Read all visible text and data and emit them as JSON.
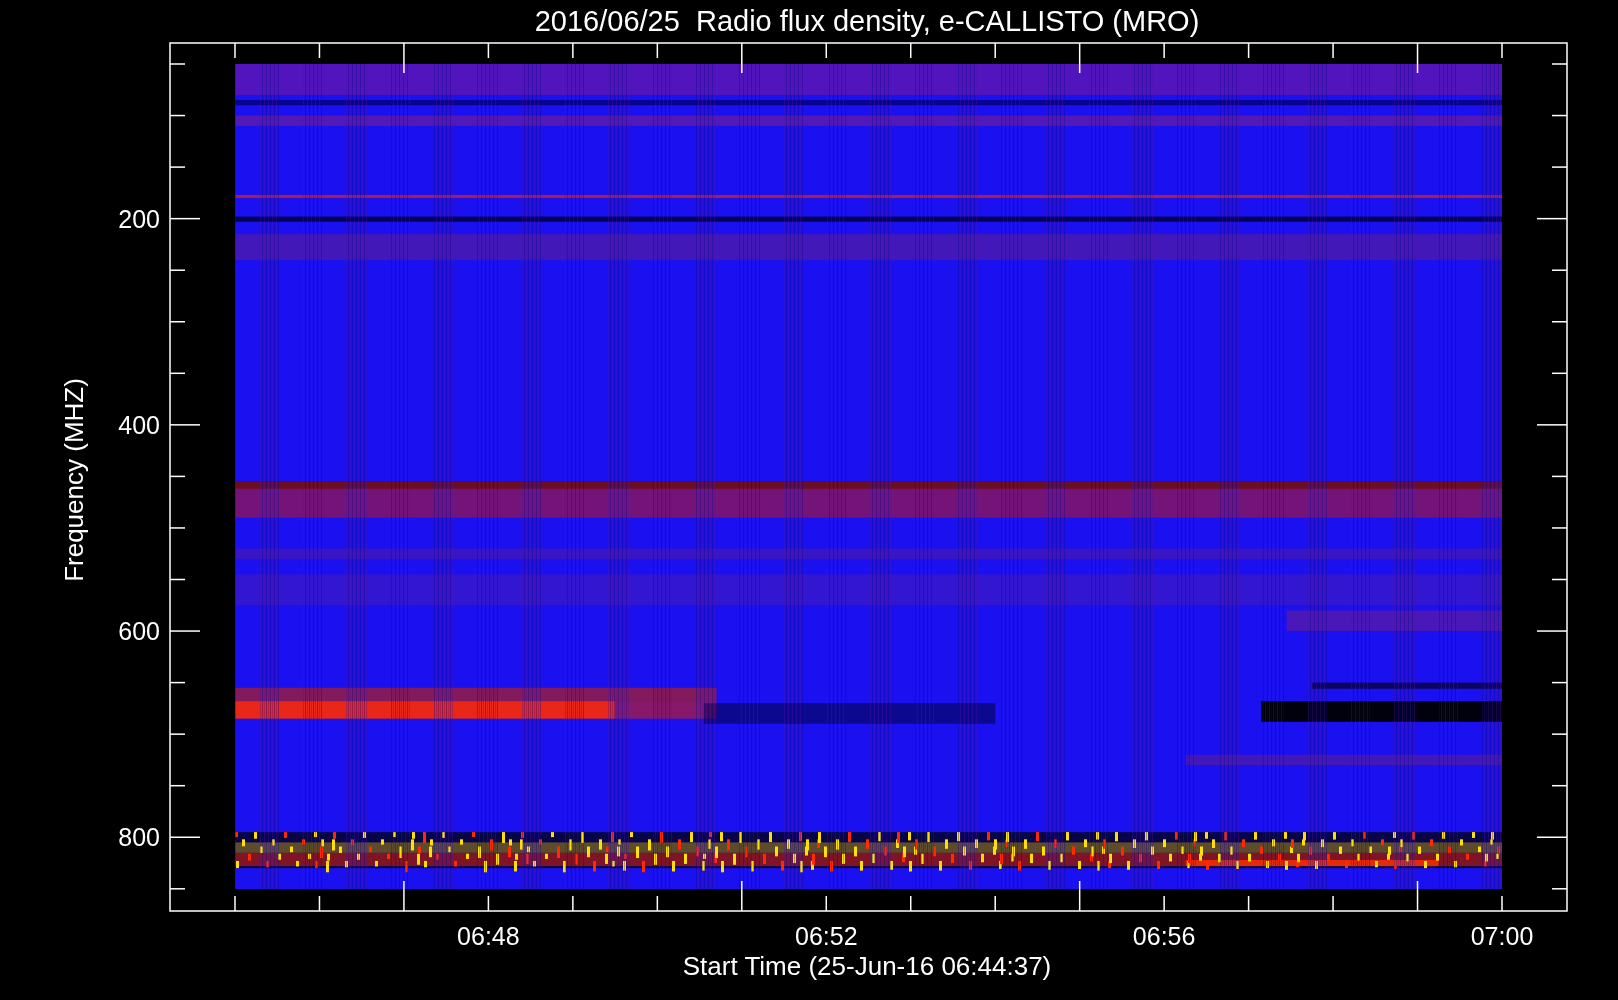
{
  "plot": {
    "title": "2016/06/25  Radio flux density, e-CALLISTO (MRO)",
    "xlabel": "Start Time (25-Jun-16 06:44:37)",
    "ylabel": "Frequency (MHZ)",
    "xtick_labels": [
      "06:48",
      "06:52",
      "06:56",
      "07:00"
    ],
    "ytick_labels": [
      "200",
      "400",
      "600",
      "800"
    ]
  }
}
